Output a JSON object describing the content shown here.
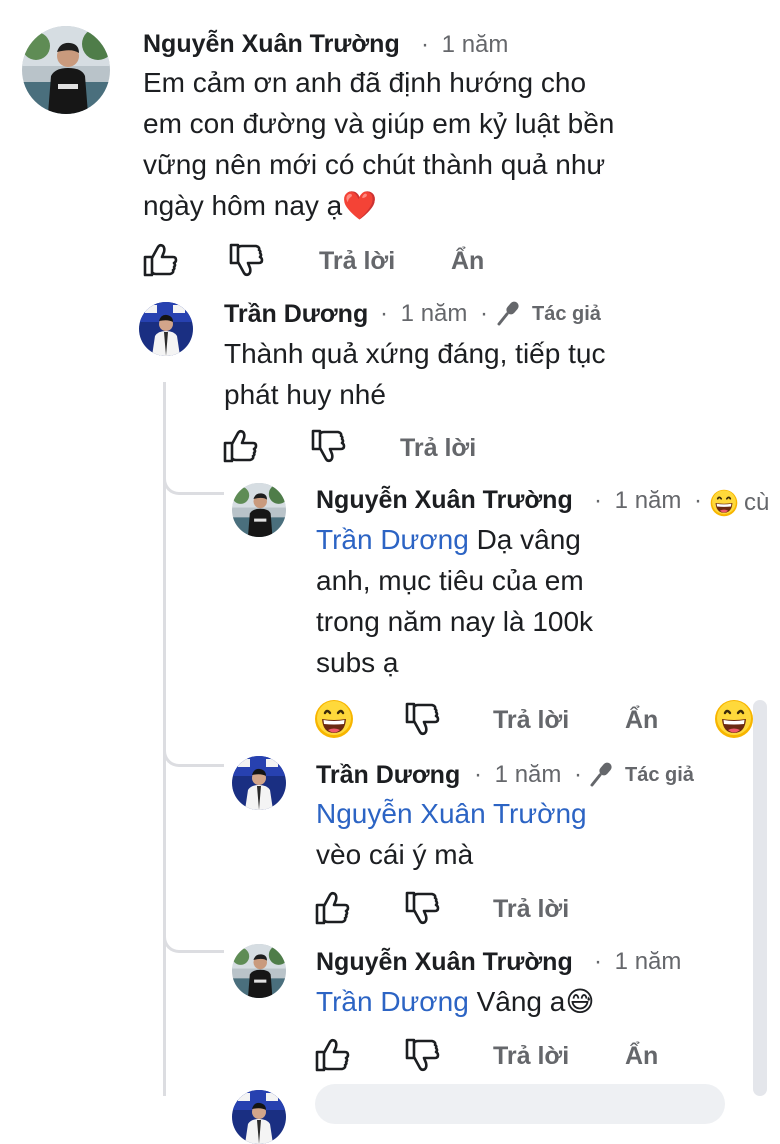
{
  "comments": [
    {
      "author": "Nguyễn Xuân Trường",
      "time": "1 năm",
      "text_lines": [
        "Em cảm ơn anh đã định hướng cho",
        "em con đường và giúp em kỷ luật bền",
        "vững nên mới có chút thành quả như",
        "ngày hôm nay ạ❤️"
      ],
      "actions": {
        "reply": "Trả lời",
        "hide": "Ẩn"
      }
    },
    {
      "author": "Trần Dương",
      "time": "1 năm",
      "badge": "Tác giả",
      "text_lines": [
        "Thành quả xứng đáng, tiếp tục",
        "phát huy nhé"
      ],
      "actions": {
        "reply": "Trả lời"
      }
    },
    {
      "author": "Nguyễn Xuân Trường",
      "time": "1 năm",
      "extra": "cù",
      "mention": "Trần Dương",
      "text_first": " Dạ vâng",
      "text_lines": [
        "anh, mục tiêu của em",
        "trong năm nay là 100k",
        "subs ạ"
      ],
      "actions": {
        "reply": "Trả lời",
        "hide": "Ẩn"
      }
    },
    {
      "author": "Trần Dương",
      "time": "1 năm",
      "badge": "Tác giả",
      "mention": "Nguyễn Xuân Trường",
      "text_lines": [
        "vèo cái ý mà"
      ],
      "actions": {
        "reply": "Trả lời"
      }
    },
    {
      "author": "Nguyễn Xuân Trường",
      "time": "1 năm",
      "mention": "Trần Dương",
      "text_first": " Vâng a😅",
      "actions": {
        "reply": "Trả lời",
        "hide": "Ẩn"
      }
    }
  ],
  "separator": "·",
  "colors": {
    "mention": "#2c64c4",
    "meta": "#65676b",
    "text": "#1c1e21"
  }
}
